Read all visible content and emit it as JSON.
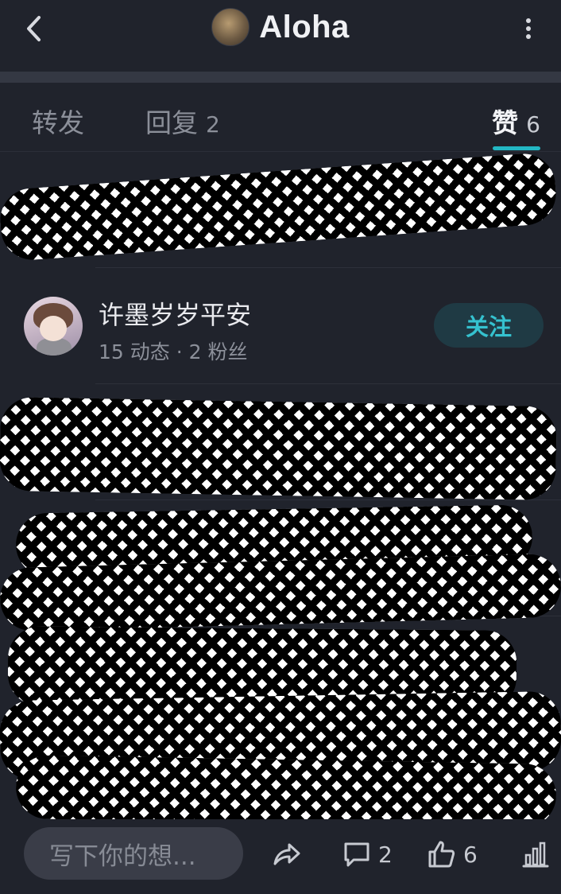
{
  "header": {
    "title": "Aloha",
    "back_icon": "chevron-left-icon",
    "more_icon": "vertical-ellipsis-icon"
  },
  "tabs": [
    {
      "label": "转发",
      "count": ""
    },
    {
      "label": "回复",
      "count": "2"
    },
    {
      "label": "赞",
      "count": "6",
      "active": true
    }
  ],
  "likers": [
    {
      "name": "许墨岁岁平安",
      "stats": "15 动态 · 2 粉丝",
      "follow_label": "关注"
    }
  ],
  "bottom_bar": {
    "input_placeholder": "写下你的想...",
    "share_icon": "share-icon",
    "comment_icon": "comment-icon",
    "comment_count": "2",
    "like_icon": "thumbs-up-icon",
    "like_count": "6",
    "stats_icon": "bar-chart-icon"
  },
  "colors": {
    "background": "#20232c",
    "accent": "#23b7c4",
    "follow_bg": "#1f3a44"
  }
}
